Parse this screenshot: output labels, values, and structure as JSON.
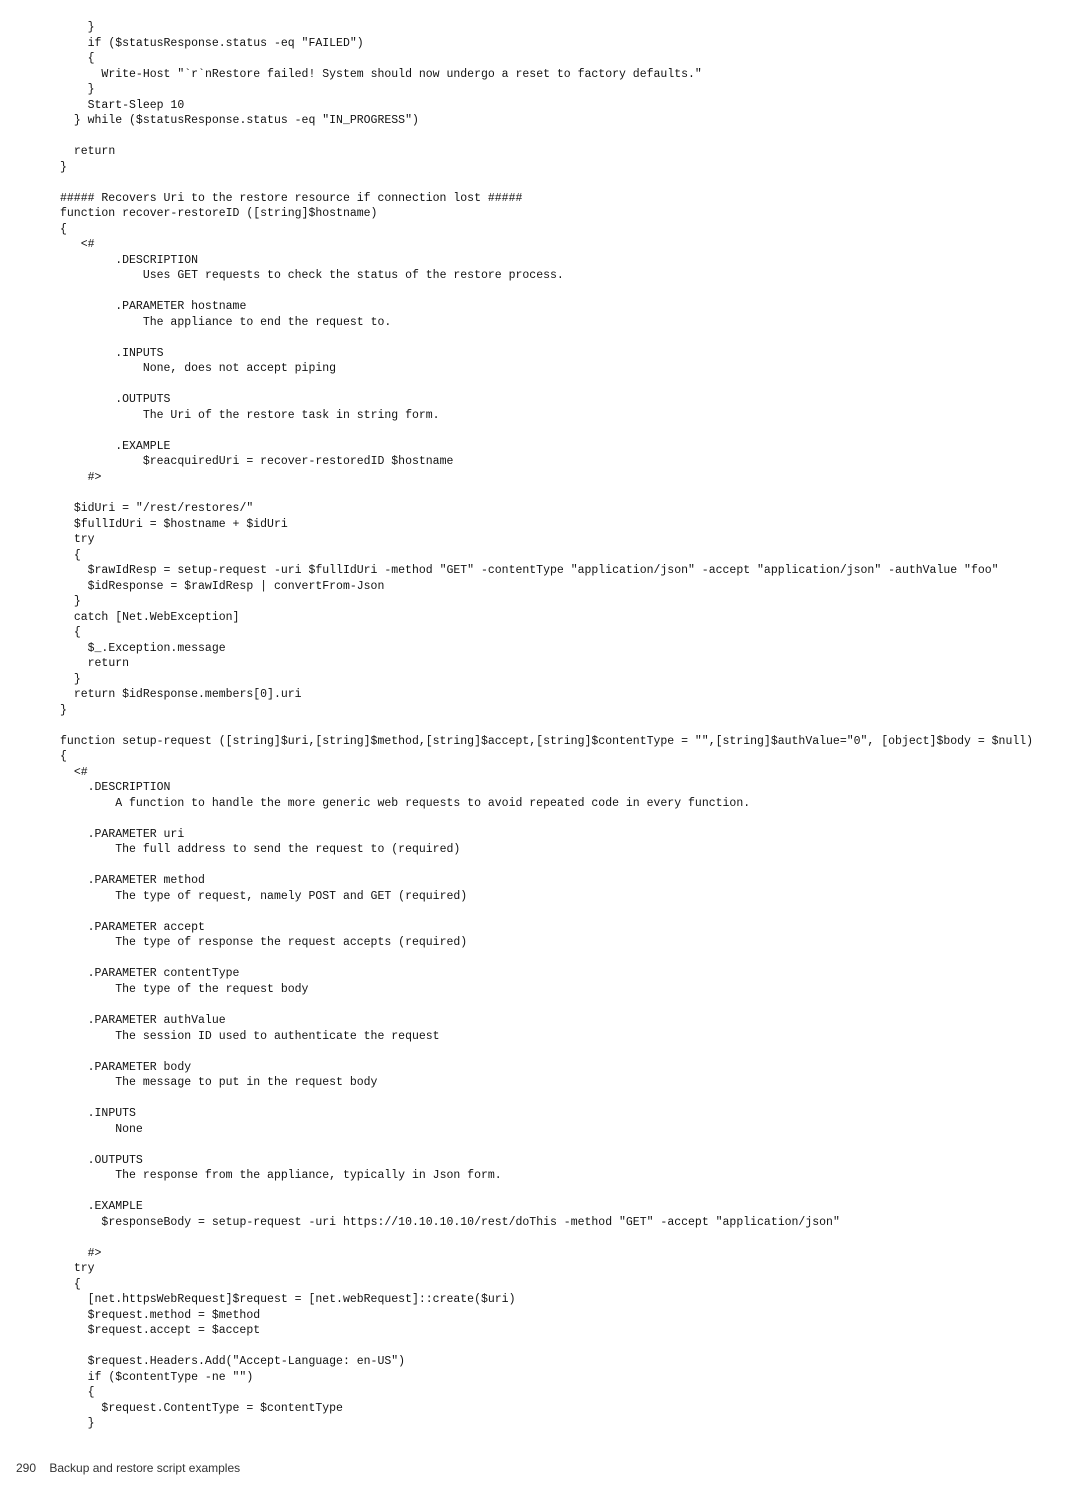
{
  "code": "    }\n    if ($statusResponse.status -eq \"FAILED\")\n    {\n      Write-Host \"`r`nRestore failed! System should now undergo a reset to factory defaults.\"\n    }\n    Start-Sleep 10\n  } while ($statusResponse.status -eq \"IN_PROGRESS\")\n\n  return\n}\n\n##### Recovers Uri to the restore resource if connection lost #####\nfunction recover-restoreID ([string]$hostname)\n{\n   <#\n        .DESCRIPTION\n            Uses GET requests to check the status of the restore process.\n\n        .PARAMETER hostname\n            The appliance to end the request to.\n\n        .INPUTS\n            None, does not accept piping\n\n        .OUTPUTS\n            The Uri of the restore task in string form.\n\n        .EXAMPLE\n            $reacquiredUri = recover-restoredID $hostname\n    #>\n\n  $idUri = \"/rest/restores/\"\n  $fullIdUri = $hostname + $idUri\n  try\n  {\n    $rawIdResp = setup-request -uri $fullIdUri -method \"GET\" -contentType \"application/json\" -accept \"application/json\" -authValue \"foo\"\n    $idResponse = $rawIdResp | convertFrom-Json\n  }\n  catch [Net.WebException]\n  {\n    $_.Exception.message\n    return\n  }\n  return $idResponse.members[0].uri\n}\n\nfunction setup-request ([string]$uri,[string]$method,[string]$accept,[string]$contentType = \"\",[string]$authValue=\"0\", [object]$body = $null)\n{\n  <#\n    .DESCRIPTION\n        A function to handle the more generic web requests to avoid repeated code in every function.\n\n    .PARAMETER uri\n        The full address to send the request to (required)\n\n    .PARAMETER method\n        The type of request, namely POST and GET (required)\n\n    .PARAMETER accept\n        The type of response the request accepts (required)\n\n    .PARAMETER contentType\n        The type of the request body\n\n    .PARAMETER authValue\n        The session ID used to authenticate the request\n\n    .PARAMETER body\n        The message to put in the request body\n\n    .INPUTS\n        None\n\n    .OUTPUTS\n        The response from the appliance, typically in Json form.\n\n    .EXAMPLE\n      $responseBody = setup-request -uri https://10.10.10.10/rest/doThis -method \"GET\" -accept \"application/json\"\n\n    #>\n  try\n  {\n    [net.httpsWebRequest]$request = [net.webRequest]::create($uri)\n    $request.method = $method\n    $request.accept = $accept\n\n    $request.Headers.Add(\"Accept-Language: en-US\")\n    if ($contentType -ne \"\")\n    {\n      $request.ContentType = $contentType\n    }",
  "footer": {
    "page_number": "290",
    "title": "Backup and restore script examples"
  }
}
